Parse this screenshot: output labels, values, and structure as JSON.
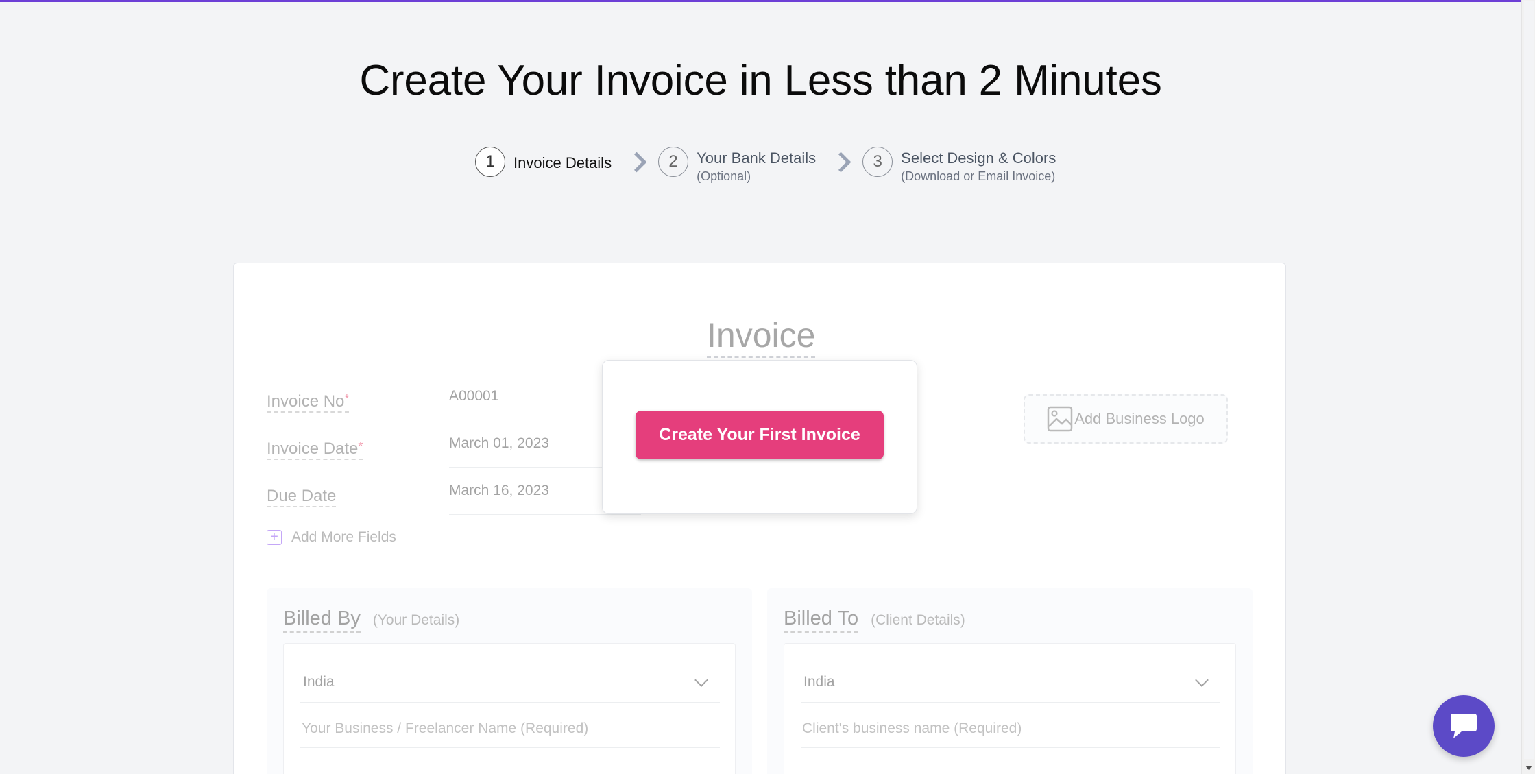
{
  "page": {
    "title": "Create Your Invoice in Less than 2 Minutes"
  },
  "steps": [
    {
      "number": "1",
      "label": "Invoice Details",
      "sub": "",
      "active": true
    },
    {
      "number": "2",
      "label": "Your Bank Details",
      "sub": "(Optional)",
      "active": false
    },
    {
      "number": "3",
      "label": "Select Design & Colors",
      "sub": "(Download or Email Invoice)",
      "active": false
    }
  ],
  "invoice": {
    "heading": "Invoice",
    "fields": [
      {
        "label": "Invoice No",
        "required": "*",
        "value": "A00001"
      },
      {
        "label": "Invoice Date",
        "required": "*",
        "value": "March 01, 2023"
      },
      {
        "label": "Due Date",
        "required": "",
        "value": "March 16, 2023"
      }
    ],
    "add_more_label": "Add More Fields",
    "add_logo_label": "Add Business Logo"
  },
  "billed_by": {
    "title": "Billed By",
    "subtitle": "(Your Details)",
    "country": "India",
    "name_placeholder": "Your Business / Freelancer Name (Required)"
  },
  "billed_to": {
    "title": "Billed To",
    "subtitle": "(Client Details)",
    "country": "India",
    "name_placeholder": "Client's business name (Required)"
  },
  "modal": {
    "cta_label": "Create Your First Invoice"
  },
  "colors": {
    "accent_top": "#6d3fd6",
    "cta": "#e53e7c",
    "chat": "#5c4ac7"
  },
  "icons": [
    "chevron-right-icon",
    "image-icon",
    "plus-icon",
    "calendar-icon",
    "chevron-down-icon",
    "chat-icon"
  ]
}
